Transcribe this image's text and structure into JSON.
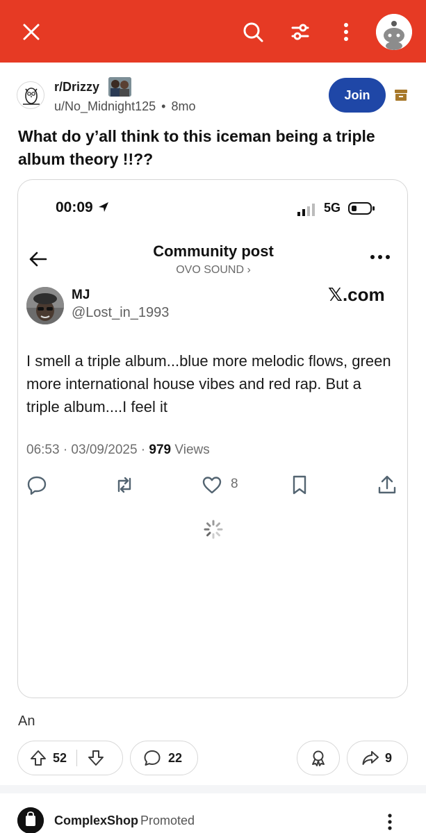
{
  "colors": {
    "brand": "#e63a24",
    "join": "#1f47a7",
    "archive": "#a7782a"
  },
  "topbar": {
    "icons": [
      "close-icon",
      "search-icon",
      "filter-icon",
      "more-vertical-icon",
      "user-avatar"
    ]
  },
  "post": {
    "subreddit": "r/Drizzy",
    "author": "u/No_Midnight125",
    "separator": "•",
    "age": "8mo",
    "join_label": "Join",
    "title": "What do y’all think to this iceman being a triple album theory !!??",
    "body_text": "An"
  },
  "embed": {
    "status_time": "00:09",
    "network": "5G",
    "nav_title": "Community post",
    "nav_sub": "OVO SOUND ›",
    "name": "MJ",
    "handle": "@Lost_in_1993",
    "source": "𝕏.com",
    "text": "I smell a triple album...blue more melodic flows, green more international house vibes and red rap. But a triple album....I feel it",
    "time": "06:53 · 03/09/2025 · ",
    "views_count": "979",
    "views_label": " Views",
    "likes": "8"
  },
  "actions": {
    "upvotes": "52",
    "comments": "22",
    "shares": "9"
  },
  "promo": {
    "name": "ComplexShop",
    "tag": "Promoted"
  }
}
